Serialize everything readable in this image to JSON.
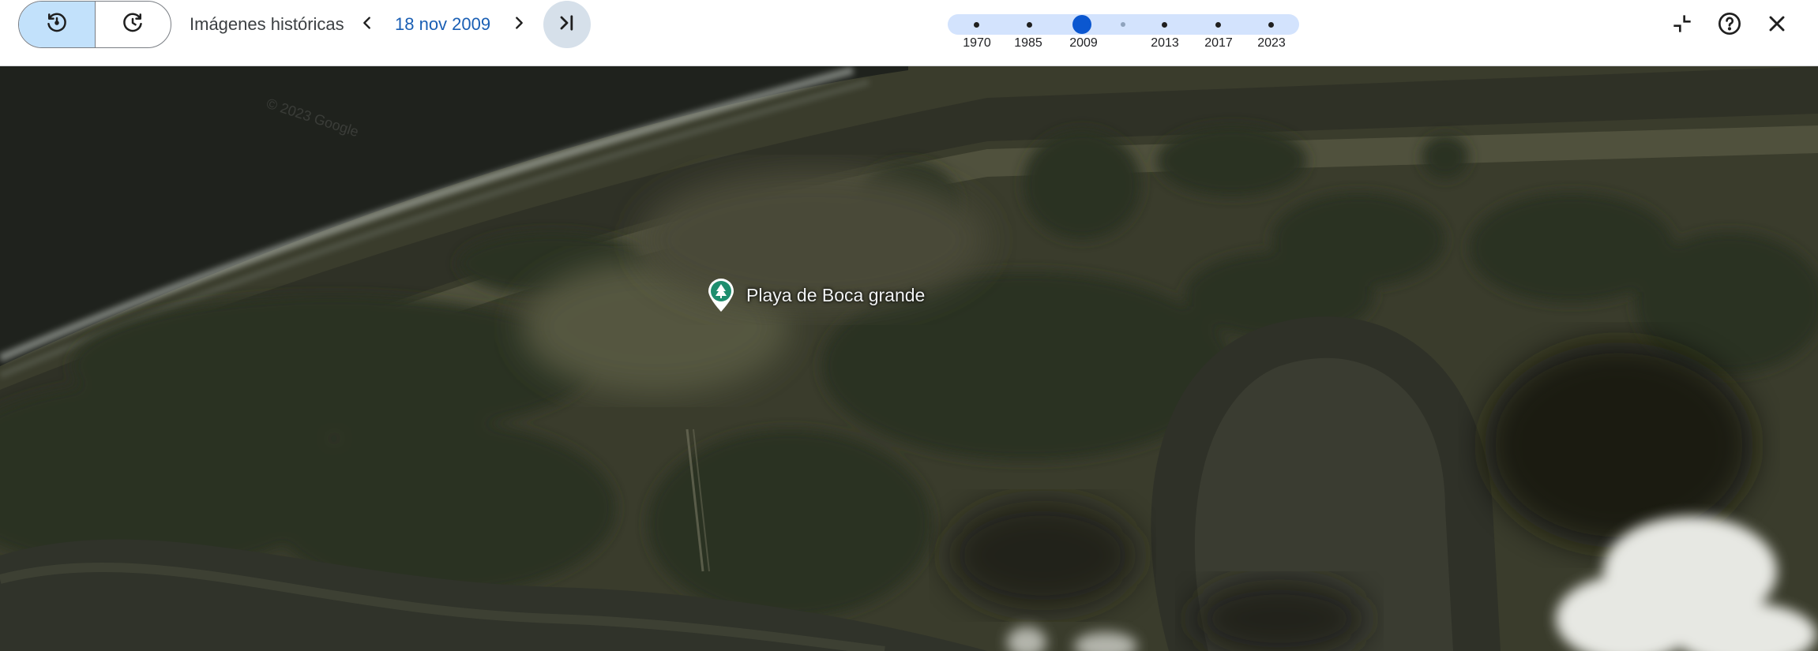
{
  "toolbar": {
    "historical_label": "Imágenes históricas",
    "current_date": "18 nov 2009"
  },
  "timeline": {
    "years": [
      "1970",
      "1985",
      "2009",
      "2013",
      "2017",
      "2023"
    ],
    "selected_year": "2009"
  },
  "map": {
    "place_label": "Playa de Boca grande",
    "watermark": "© 2023 Google"
  },
  "icons": {
    "history": "history-icon",
    "timelapse": "timelapse-icon",
    "previous": "chevron-left-icon",
    "next": "chevron-right-icon",
    "latest": "skip-to-latest-icon",
    "collapse": "collapse-icon",
    "help": "help-icon",
    "close": "close-icon",
    "poi": "park-pin-icon"
  },
  "colors": {
    "accent": "#0b57d0",
    "date_text": "#1a5fb4",
    "timeline_track": "#d3e3fd",
    "segment_active": "#c2e1fb",
    "poi_pin": "#1e8e6e"
  }
}
